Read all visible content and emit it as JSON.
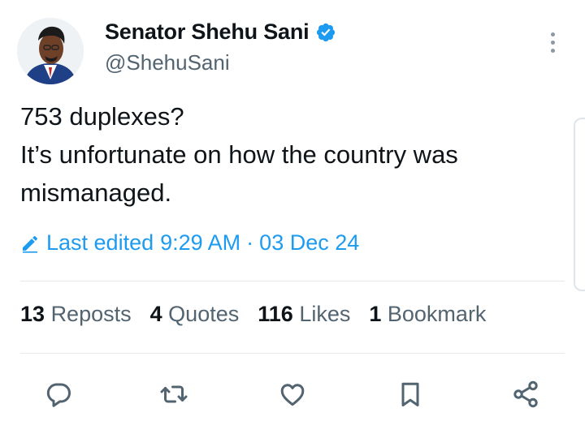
{
  "author": {
    "name": "Senator Shehu Sani",
    "handle": "@ShehuSani",
    "avatar_icon": "user-avatar-photo",
    "verified_color": "#1d9bf0"
  },
  "tweet": {
    "text": "753 duplexes?\nIt’s unfortunate on how the country was mismanaged.",
    "edited_label": "Last edited",
    "time": "9:29 AM",
    "separator": "·",
    "date": "03 Dec 24",
    "accent_color": "#1d9bf0"
  },
  "stats": [
    {
      "count": "13",
      "label": "Reposts"
    },
    {
      "count": "4",
      "label": "Quotes"
    },
    {
      "count": "116",
      "label": "Likes"
    },
    {
      "count": "1",
      "label": "Bookmark"
    }
  ],
  "actions": [
    {
      "icon": "reply-icon"
    },
    {
      "icon": "repost-icon"
    },
    {
      "icon": "like-icon"
    },
    {
      "icon": "bookmark-icon"
    },
    {
      "icon": "share-icon"
    }
  ]
}
